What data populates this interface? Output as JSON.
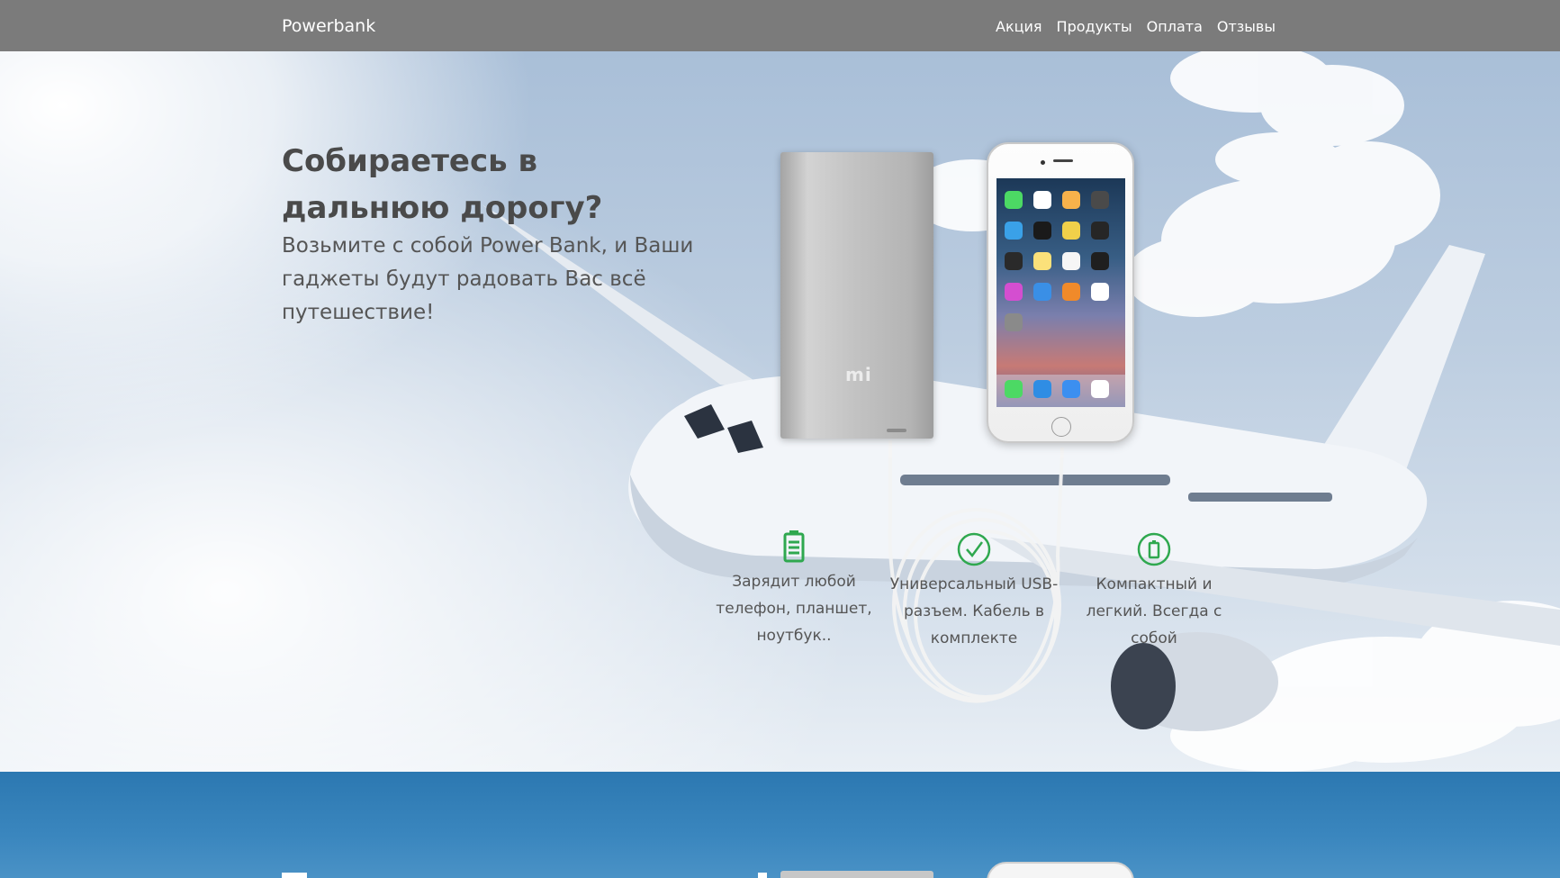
{
  "navbar": {
    "brand": "Powerbank",
    "links": [
      "Акция",
      "Продукты",
      "Оплата",
      "Отзывы"
    ]
  },
  "hero": {
    "title": "Собираетесь в дальнюю дорогу?",
    "subtitle": "Возьмите с собой Power Bank, и Ваши гаджеты будут радовать Вас всё путешествие!",
    "powerbank_logo": "mi",
    "features": [
      {
        "icon": "battery-icon",
        "text": "Зарядит любой телефон, планшет, ноутбук.."
      },
      {
        "icon": "check-circle-icon",
        "text": "Универсальный USB-разъем. Кабель в комплекте"
      },
      {
        "icon": "compact-battery-icon",
        "text": "Компактный и легкий. Всегда с собой"
      }
    ]
  },
  "colors": {
    "navbar_bg": "#7b7b7b",
    "accent_green": "#2fa84f",
    "next_section_bg": "#2c78b1"
  }
}
